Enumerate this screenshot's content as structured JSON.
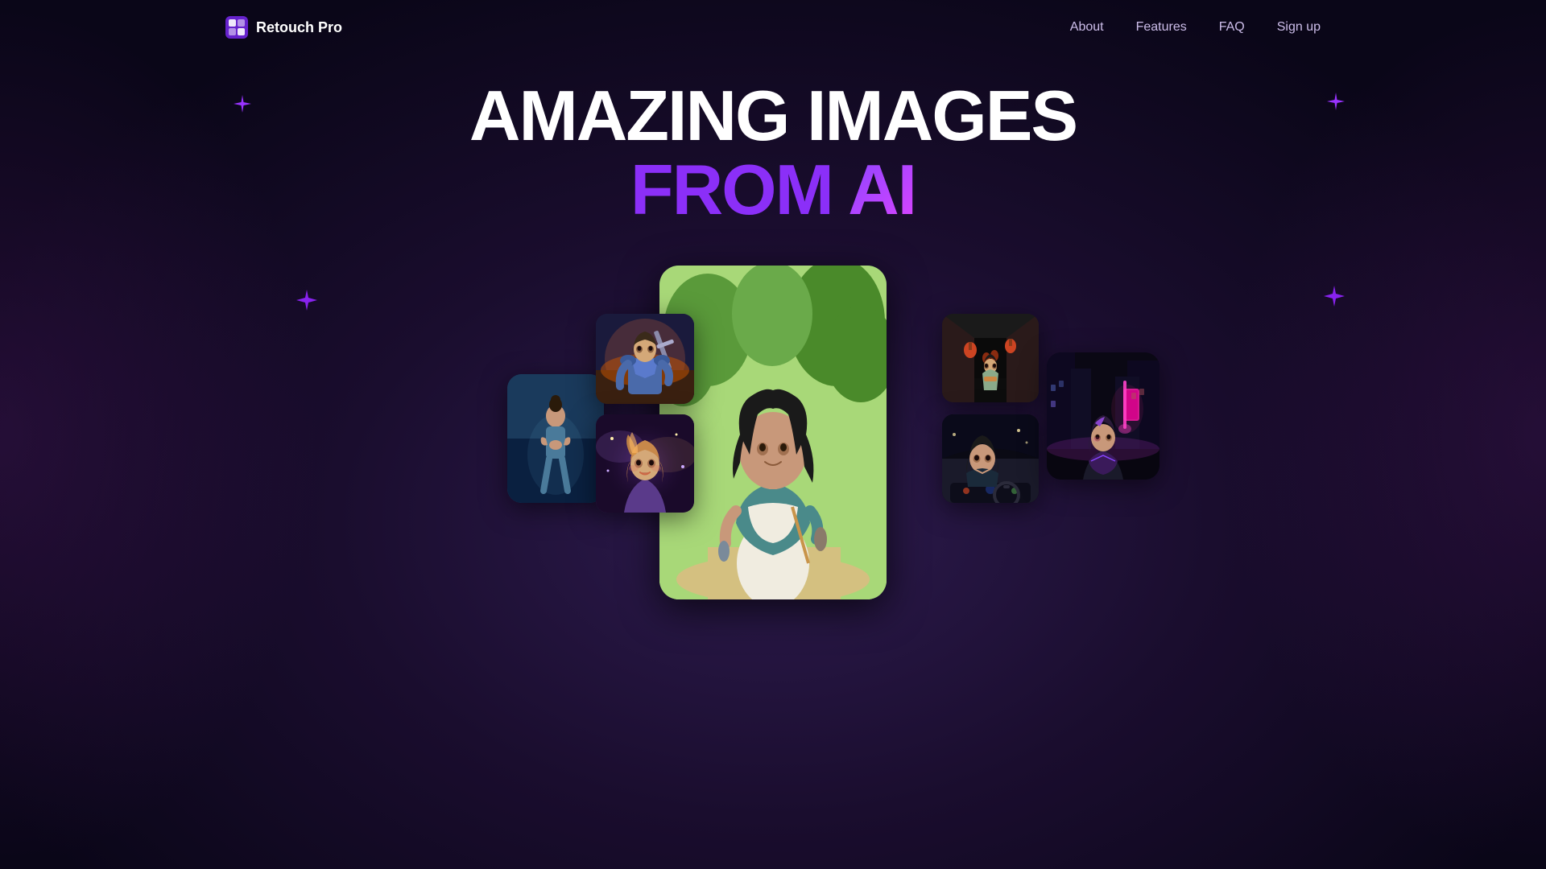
{
  "brand": {
    "name": "Retouch Pro",
    "logo_icon": "✦"
  },
  "nav": {
    "links": [
      {
        "label": "About",
        "href": "#about"
      },
      {
        "label": "Features",
        "href": "#features"
      },
      {
        "label": "FAQ",
        "href": "#faq"
      },
      {
        "label": "Sign up",
        "href": "#signup"
      }
    ]
  },
  "hero": {
    "line1": "AMAZING IMAGES",
    "line2_from": "FROM",
    "line2_ai": "AI"
  },
  "sparkles": [
    {
      "id": "sparkle-top-left",
      "size": 22
    },
    {
      "id": "sparkle-top-right",
      "size": 22
    },
    {
      "id": "sparkle-mid-left",
      "size": 26
    },
    {
      "id": "sparkle-mid-right",
      "size": 26
    }
  ],
  "cards": [
    {
      "id": "center",
      "desc": "Woman in park, anime style"
    },
    {
      "id": "left-large",
      "desc": "Woman doing yoga"
    },
    {
      "id": "left-top",
      "desc": "Woman warrior hero"
    },
    {
      "id": "left-bottom",
      "desc": "Fantasy woman portrait"
    },
    {
      "id": "right-top",
      "desc": "Woman in Japanese alley"
    },
    {
      "id": "right-bottom",
      "desc": "Woman in car"
    },
    {
      "id": "right-far",
      "desc": "Woman in cyberpunk city"
    }
  ]
}
